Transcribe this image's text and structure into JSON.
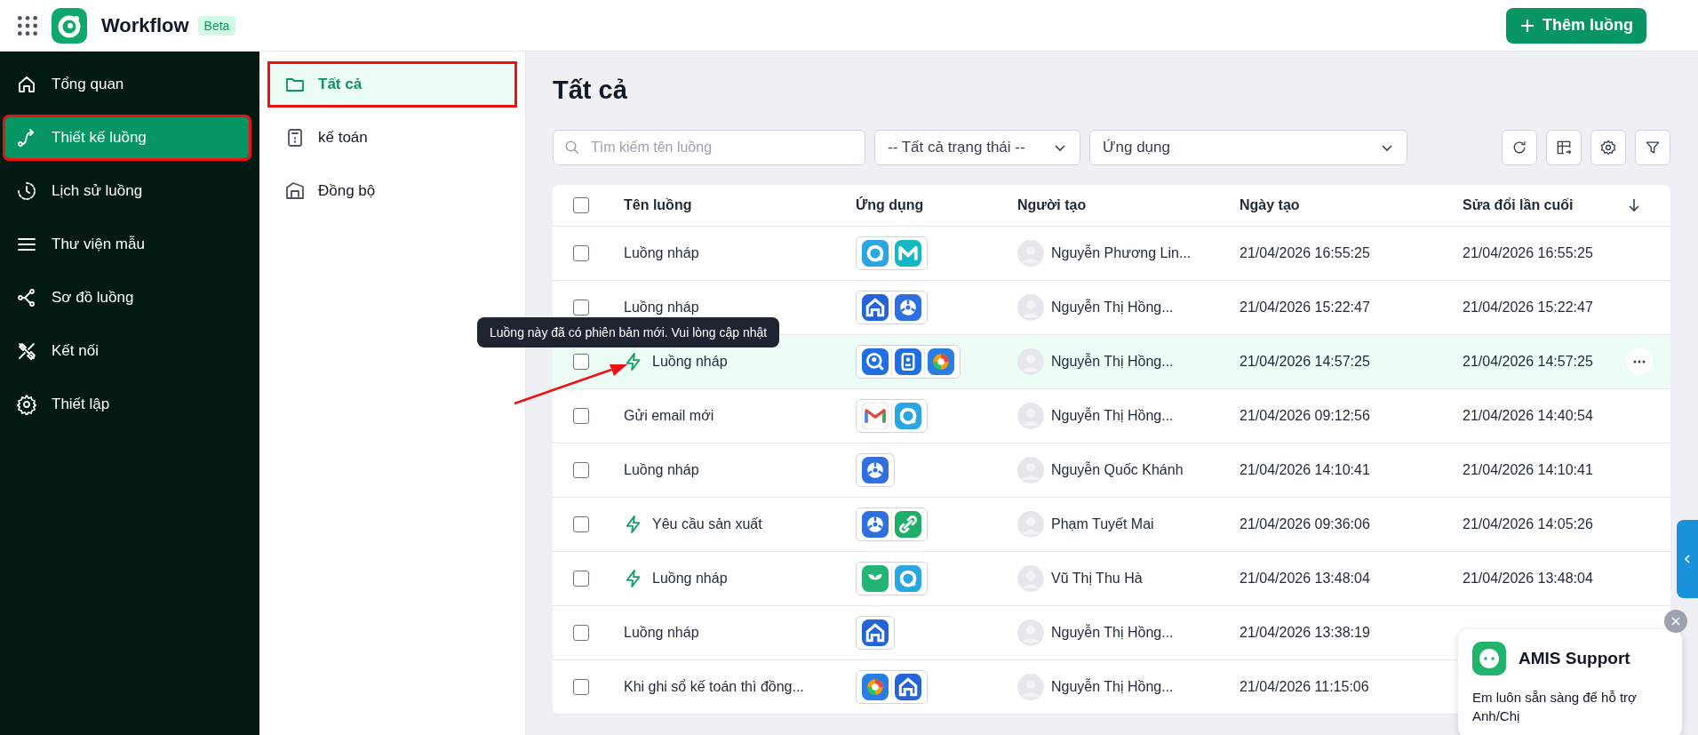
{
  "app": {
    "name": "Workflow",
    "badge": "Beta",
    "add_button": "Thêm luồng"
  },
  "sidebar": {
    "items": [
      {
        "label": "Tổng quan",
        "selected": false
      },
      {
        "label": "Thiết kế luồng",
        "selected": true
      },
      {
        "label": "Lịch sử luồng",
        "selected": false
      },
      {
        "label": "Thư viện mẫu",
        "selected": false
      },
      {
        "label": "Sơ đồ luồng",
        "selected": false
      },
      {
        "label": "Kết nối",
        "selected": false
      },
      {
        "label": "Thiết lập",
        "selected": false
      }
    ]
  },
  "folders": [
    {
      "label": "Tất cả",
      "selected": true
    },
    {
      "label": "kế toán",
      "selected": false
    },
    {
      "label": "Đồng bộ",
      "selected": false
    }
  ],
  "page_title": "Tất cả",
  "search": {
    "placeholder": "Tìm kiếm tên luồng"
  },
  "status_filter": {
    "value": "-- Tất cả trạng thái --"
  },
  "app_filter": {
    "placeholder": "Ứng dụng"
  },
  "table": {
    "all_checked": false,
    "columns": [
      "Tên luồng",
      "Ứng dụng",
      "Người tạo",
      "Ngày tạo",
      "Sửa đổi lần cuối"
    ],
    "rows": [
      {
        "name": "Luồng nháp",
        "update": false,
        "hovered": false,
        "checked": false,
        "apps": [
          {
            "kind": "ring"
          },
          {
            "kind": "m"
          }
        ],
        "creator": "Nguyễn Phương Lin...",
        "created": "21/04/2026 16:55:25",
        "modified": "21/04/2026 16:55:25"
      },
      {
        "name": "Luồng nháp",
        "update": false,
        "hovered": false,
        "checked": false,
        "apps": [
          {
            "kind": "house"
          },
          {
            "kind": "fan"
          }
        ],
        "creator": "Nguyễn Thị Hồng...",
        "created": "21/04/2026 15:22:47",
        "modified": "21/04/2026 15:22:47"
      },
      {
        "name": "Luồng nháp",
        "update": true,
        "hovered": true,
        "checked": false,
        "apps": [
          {
            "kind": "person-search"
          },
          {
            "kind": "contact"
          },
          {
            "kind": "wheel"
          }
        ],
        "creator": "Nguyễn Thị Hồng...",
        "created": "21/04/2026 14:57:25",
        "modified": "21/04/2026 14:57:25"
      },
      {
        "name": "Gửi email mới",
        "update": false,
        "hovered": false,
        "checked": false,
        "apps": [
          {
            "kind": "mail"
          },
          {
            "kind": "ring"
          }
        ],
        "creator": "Nguyễn Thị Hồng...",
        "created": "21/04/2026 09:12:56",
        "modified": "21/04/2026 14:40:54"
      },
      {
        "name": "Luồng nháp",
        "update": false,
        "hovered": false,
        "checked": false,
        "apps": [
          {
            "kind": "fan"
          }
        ],
        "creator": "Nguyễn Quốc Khánh",
        "created": "21/04/2026 14:10:41",
        "modified": "21/04/2026 14:10:41"
      },
      {
        "name": "Yêu cầu sản xuất",
        "update": true,
        "hovered": false,
        "checked": false,
        "apps": [
          {
            "kind": "fan"
          },
          {
            "kind": "link"
          }
        ],
        "creator": "Phạm Tuyết Mai",
        "created": "21/04/2026 09:36:06",
        "modified": "21/04/2026 14:05:26"
      },
      {
        "name": "Luồng nháp",
        "update": true,
        "hovered": false,
        "checked": false,
        "apps": [
          {
            "kind": "sprout"
          },
          {
            "kind": "ring"
          }
        ],
        "creator": "Vũ Thị Thu Hà",
        "created": "21/04/2026 13:48:04",
        "modified": "21/04/2026 13:48:04"
      },
      {
        "name": "Luồng nháp",
        "update": false,
        "hovered": false,
        "checked": false,
        "apps": [
          {
            "kind": "house"
          }
        ],
        "creator": "Nguyễn Thị Hồng...",
        "created": "21/04/2026 13:38:19"
      },
      {
        "name": "Khi ghi sổ kế toán thì đồng...",
        "update": false,
        "hovered": false,
        "checked": false,
        "apps": [
          {
            "kind": "wheel"
          },
          {
            "kind": "house"
          }
        ],
        "creator": "Nguyễn Thị Hồng...",
        "created": "21/04/2026 11:15:06"
      }
    ]
  },
  "tooltip": "Luồng này đã có phiên bản mới. Vui lòng cập nhật",
  "support": {
    "title": "AMIS Support",
    "message": "Em luôn sẵn sàng để hỗ trợ Anh/Chị"
  }
}
